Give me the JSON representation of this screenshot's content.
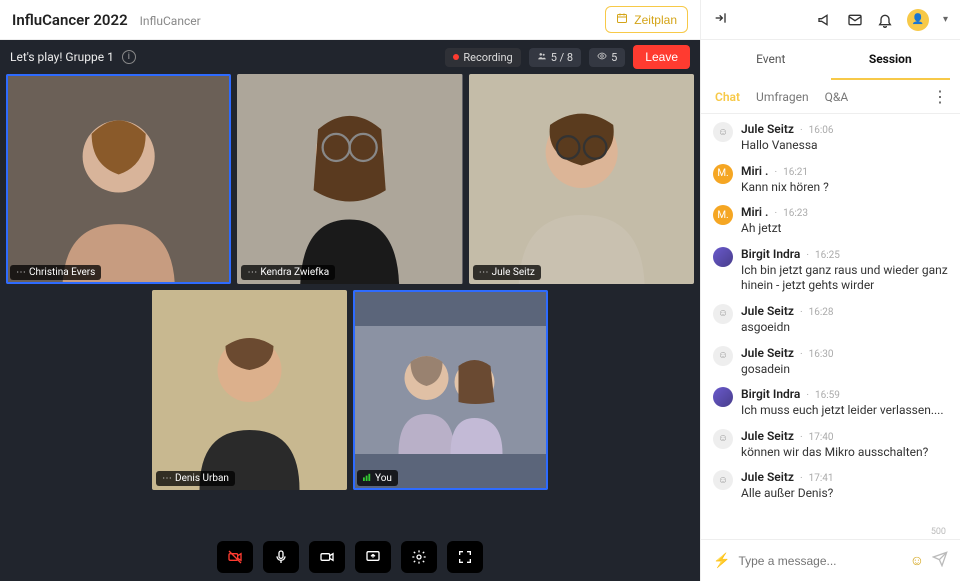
{
  "header": {
    "event_title": "InfluCancer 2022",
    "event_sub": "InfluCancer",
    "schedule_label": "Zeitplan"
  },
  "session": {
    "title": "Let's play! Gruppe 1",
    "recording_label": "Recording",
    "participants_label": "5 / 8",
    "viewers_label": "5",
    "leave_label": "Leave"
  },
  "tiles": [
    {
      "name": "Christina Evers",
      "active": true
    },
    {
      "name": "Kendra Zwiefka",
      "active": false
    },
    {
      "name": "Jule Seitz",
      "active": false
    },
    {
      "name": "Denis Urban",
      "active": false
    },
    {
      "name": "You",
      "active": true
    }
  ],
  "controls": {
    "camera_off_icon": "camera-off",
    "mic_icon": "mic",
    "video_icon": "video",
    "share_icon": "share-screen",
    "settings_icon": "gear",
    "fullscreen_icon": "fullscreen"
  },
  "top_tabs": {
    "event": "Event",
    "session": "Session"
  },
  "sub_tabs": {
    "chat": "Chat",
    "polls": "Umfragen",
    "qa": "Q&A"
  },
  "chat_messages": [
    {
      "user": "Jule Seitz",
      "time": "16:06",
      "text": "Hallo Vanessa",
      "av": "gray"
    },
    {
      "user": "Miri .",
      "time": "16:21",
      "text": "Kann nix hören ?",
      "av": "orange"
    },
    {
      "user": "Miri .",
      "time": "16:23",
      "text": "Ah jetzt",
      "av": "orange"
    },
    {
      "user": "Birgit Indra",
      "time": "16:25",
      "text": "Ich bin jetzt ganz raus und wieder ganz hinein - jetzt gehts wirder",
      "av": "purple"
    },
    {
      "user": "Jule Seitz",
      "time": "16:28",
      "text": "asgoeidn",
      "av": "gray"
    },
    {
      "user": "Jule Seitz",
      "time": "16:30",
      "text": "gosadein",
      "av": "gray"
    },
    {
      "user": "Birgit Indra",
      "time": "16:59",
      "text": "Ich muss euch jetzt leider verlassen....",
      "av": "purple"
    },
    {
      "user": "Jule Seitz",
      "time": "17:40",
      "text": "können wir das Mikro ausschalten?",
      "av": "gray"
    },
    {
      "user": "Jule Seitz",
      "time": "17:41",
      "text": "Alle außer Denis?",
      "av": "gray"
    }
  ],
  "compose": {
    "placeholder": "Type a message...",
    "count": "500"
  }
}
